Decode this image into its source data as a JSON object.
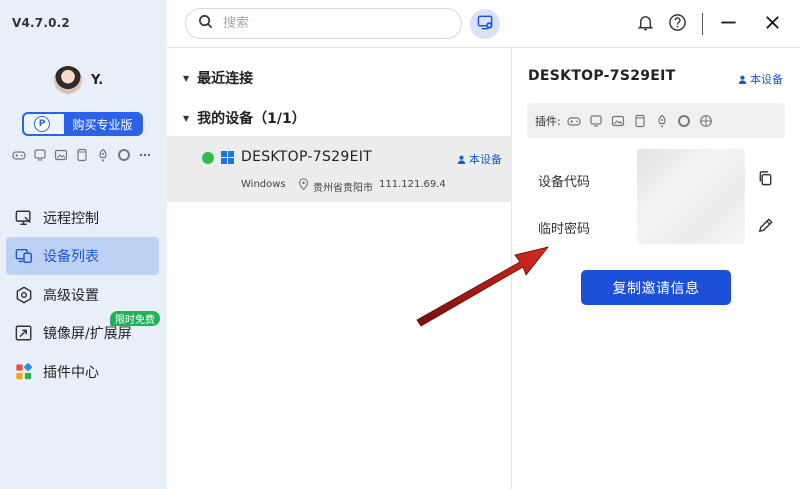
{
  "app": {
    "version": "V4.7.0.2"
  },
  "user": {
    "name": "Y."
  },
  "sidebar": {
    "buy_pro_icon": "P",
    "buy_pro_label": "购买专业版",
    "nav": [
      {
        "label": "远程控制",
        "icon": "monitor-icon"
      },
      {
        "label": "设备列表",
        "icon": "devices-icon"
      },
      {
        "label": "高级设置",
        "icon": "settings-icon"
      },
      {
        "label": "镜像屏/扩展屏",
        "icon": "mirror-icon",
        "badge": "限时免费"
      },
      {
        "label": "插件中心",
        "icon": "plugin-center-icon"
      }
    ],
    "active_index": 1
  },
  "search": {
    "placeholder": "搜索"
  },
  "device_list": {
    "recent_label": "最近连接",
    "my_devices_label": "我的设备（1/1）",
    "device": {
      "name": "DESKTOP-7S29EIT",
      "status": "online",
      "tag": "本设备",
      "os": "Windows",
      "location": "贵州省贵阳市",
      "ip": "111.121.69.4"
    }
  },
  "detail": {
    "title": "DESKTOP-7S29EIT",
    "tag": "本设备",
    "plugins_label": "插件:",
    "device_code_label": "设备代码",
    "temp_password_label": "临时密码",
    "invite_button": "复制邀请信息"
  },
  "colors": {
    "accent": "#1c50d8",
    "online": "#2dbd4d",
    "badge": "#20b25a",
    "annotation_arrow": "#c0201a"
  }
}
